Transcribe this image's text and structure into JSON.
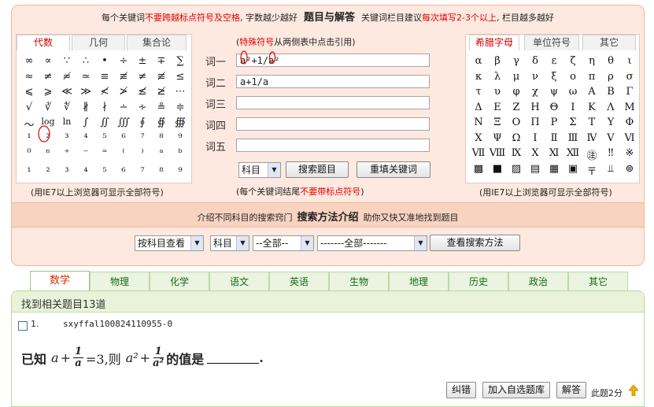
{
  "top_notice": {
    "part1": "每个关键词",
    "part2_red": "不要跨越标点符号及空格",
    "part3": ", 字数越少越好",
    "title": "题目与解答",
    "part4": "关键词栏目建议",
    "part5_red": "每次填写2-3个以上",
    "part6": ", 栏目越多越好"
  },
  "left_panel": {
    "tabs": [
      "代数",
      "几何",
      "集合论"
    ],
    "active_tab": 0,
    "symbols": [
      "∞",
      "∝",
      "∵",
      "∴",
      "•",
      "÷",
      "±",
      "∓",
      "∑",
      "≈",
      "≠",
      "≉",
      "≃",
      "≡",
      "≢",
      "≠",
      "≢",
      "≤",
      "⩽",
      "⩾",
      "≪",
      "≫",
      "≮",
      "≯",
      "≰",
      "≱",
      "⋯",
      "√",
      "∛",
      "∜",
      "∦",
      "∤",
      "∸",
      "∻",
      "≗",
      "≑",
      "～",
      "log",
      "ln",
      "∫",
      "∬",
      "∭",
      "∮",
      "∯",
      "∰",
      "¹",
      "²",
      "³",
      "⁴",
      "⁵",
      "⁶",
      "⁷",
      "⁸",
      "⁹",
      "⁰",
      "ⁿ",
      "⁺",
      "⁻",
      "⁼",
      "⁽",
      "⁾",
      "ᵃ",
      "ᵇ",
      "₁",
      "₂",
      "₃",
      "₄",
      "₅",
      "₆",
      "₇",
      "₈",
      "₉"
    ],
    "note": "(用IE7以上浏览器可显示全部符号)"
  },
  "center_panel": {
    "hint_red": "特殊符号",
    "hint_rest": "从两侧表中点击引用)",
    "hint_open": "(",
    "keyword_labels": [
      "词一",
      "词二",
      "词三",
      "词四",
      "词五"
    ],
    "keyword_values": [
      "a²+1/a²",
      "a+1/a",
      "",
      "",
      ""
    ],
    "subject_select": "科目",
    "search_button": "搜索题目",
    "reset_button": "重填关键词",
    "footer_open": "(每个关键词结尾",
    "footer_red": "不要带标点符号",
    "footer_close": ")"
  },
  "right_panel": {
    "tabs": [
      "希腊字母",
      "单位符号",
      "其它"
    ],
    "active_tab": 0,
    "symbols": [
      "α",
      "β",
      "γ",
      "δ",
      "ε",
      "ζ",
      "η",
      "θ",
      "ι",
      "κ",
      "λ",
      "μ",
      "ν",
      "ξ",
      "ο",
      "π",
      "ρ",
      "σ",
      "τ",
      "υ",
      "φ",
      "χ",
      "ψ",
      "ω",
      "Α",
      "Β",
      "Γ",
      "Δ",
      "Ε",
      "Ζ",
      "Η",
      "Θ",
      "Ι",
      "Κ",
      "Λ",
      "Μ",
      "Ν",
      "Ξ",
      "Ο",
      "Π",
      "Ρ",
      "Σ",
      "Τ",
      "Υ",
      "Φ",
      "Χ",
      "Ψ",
      "Ω",
      "Ⅰ",
      "Ⅱ",
      "Ⅲ",
      "Ⅳ",
      "Ⅴ",
      "Ⅵ",
      "Ⅶ",
      "Ⅷ",
      "Ⅸ",
      "Ⅹ",
      "Ⅺ",
      "Ⅻ",
      "㊟",
      "‼",
      "※",
      "▩",
      "■",
      "▨",
      "▤",
      "▦",
      "▣",
      "〒",
      "⫫",
      "⊜"
    ],
    "note": "(用IE7以上浏览器可显示全部符号)"
  },
  "method_bar": {
    "part1": "介绍不同科目的搜索窍门",
    "title": "搜索方法介绍",
    "part2": "助你又快又准地找到题目"
  },
  "method_controls": {
    "view_select": "按科目查看",
    "subject_select": "科目",
    "category_select": "--全部--",
    "sub_select": "-------全部-------",
    "view_button": "查看搜索方法"
  },
  "subject_tabs": [
    "数学",
    "物理",
    "化学",
    "语文",
    "英语",
    "生物",
    "地理",
    "历史",
    "政治",
    "其它"
  ],
  "active_subject": 0,
  "results": {
    "count_text": "找到相关题目13道",
    "question": {
      "number": "1.",
      "id": "sxyffal100824110955-0",
      "prefix": "已知",
      "a_var": "a",
      "plus1": "+",
      "frac1_num": "1",
      "frac1_den": "a",
      "eq": "=3,则",
      "a2": "a²",
      "plus2": "+",
      "frac2_num": "1",
      "frac2_den": "a²",
      "suffix": "的值是",
      "period": "."
    },
    "buttons": {
      "error": "纠错",
      "add": "加入自选题库",
      "answer": "解答"
    },
    "score": "此题2分"
  },
  "colors": {
    "accent_red": "#e60000",
    "panel_bg": "#fde9df",
    "tab_green": "#126a12"
  }
}
